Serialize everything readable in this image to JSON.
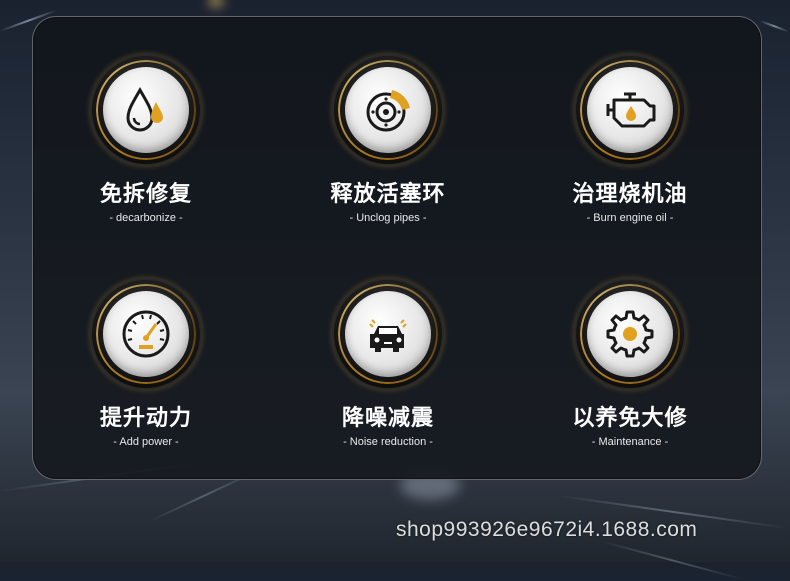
{
  "features": [
    {
      "title": "免拆修复",
      "subtitle": "- decarbonize -",
      "icon": "oil-drops-icon"
    },
    {
      "title": "释放活塞环",
      "subtitle": "- Unclog pipes -",
      "icon": "brake-disc-icon"
    },
    {
      "title": "治理烧机油",
      "subtitle": "- Burn engine oil -",
      "icon": "engine-oil-icon"
    },
    {
      "title": "提升动力",
      "subtitle": "- Add power -",
      "icon": "speedometer-icon"
    },
    {
      "title": "降噪减震",
      "subtitle": "- Noise reduction -",
      "icon": "car-front-icon"
    },
    {
      "title": "以养免大修",
      "subtitle": "- Maintenance -",
      "icon": "gear-icon"
    }
  ],
  "watermark": "shop993926e9672i4.1688.com",
  "colors": {
    "accent": "#e0a020",
    "icon_dark": "#1a1a1a",
    "panel": "#15191f"
  }
}
